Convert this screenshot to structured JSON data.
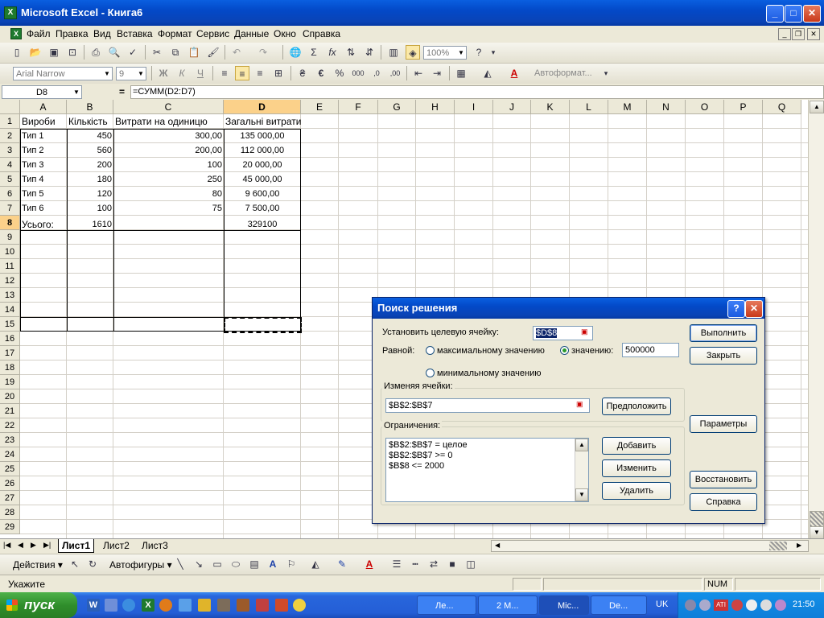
{
  "window": {
    "title": "Microsoft Excel - Книга6"
  },
  "menu": {
    "items": [
      "Файл",
      "Правка",
      "Вид",
      "Вставка",
      "Формат",
      "Сервис",
      "Данные",
      "Окно",
      "Справка"
    ]
  },
  "toolbar": {
    "zoom": "100%",
    "font_name": "Arial Narrow",
    "font_size": "9",
    "autoformat_label": "Автоформат...",
    "bold": "Ж",
    "italic": "К",
    "underline": "Ч",
    "thousands": "000"
  },
  "formula_bar": {
    "name_box": "D8",
    "eq": "=",
    "formula": "=СУММ(D2:D7)"
  },
  "sheet": {
    "columns": [
      "A",
      "B",
      "C",
      "D",
      "E",
      "F",
      "G",
      "H",
      "I",
      "J",
      "K",
      "L",
      "M",
      "N",
      "O",
      "P",
      "Q"
    ],
    "rows": [
      "1",
      "2",
      "3",
      "4",
      "5",
      "6",
      "7",
      "8",
      "9",
      "10",
      "11",
      "12",
      "13",
      "14",
      "15",
      "16",
      "17",
      "18",
      "19",
      "20",
      "21",
      "22",
      "23",
      "24",
      "25",
      "26",
      "27",
      "28",
      "29"
    ],
    "header": [
      "Вироби",
      "Кількість",
      "Витрати на одиницю",
      "Загальні витрати"
    ],
    "data": [
      [
        "Тип 1",
        "450",
        "300,00",
        "135 000,00"
      ],
      [
        "Тип 2",
        "560",
        "200,00",
        "112 000,00"
      ],
      [
        "Тип 3",
        "200",
        "100",
        "20 000,00"
      ],
      [
        "Тип 4",
        "180",
        "250",
        "45 000,00"
      ],
      [
        "Тип 5",
        "120",
        "80",
        "9 600,00"
      ],
      [
        "Тип 6",
        "100",
        "75",
        "7 500,00"
      ]
    ],
    "total": [
      "Усього:",
      "1610",
      "",
      "329100"
    ]
  },
  "tabs": [
    "Лист1",
    "Лист2",
    "Лист3"
  ],
  "drawing": {
    "actions": "Действия",
    "autoshapes": "Автофигуры"
  },
  "status": {
    "text": "Укажите",
    "num": "NUM"
  },
  "dialog": {
    "title": "Поиск решения",
    "help": "?",
    "target_label": "Установить целевую ячейку:",
    "target_value": "$D$8",
    "equal_label": "Равной:",
    "opt_max": "максимальному значению",
    "opt_value": "значению:",
    "value": "500000",
    "opt_min": "минимальному значению",
    "changing_label": "Изменяя ячейки:",
    "changing_value": "$B$2:$B$7",
    "guess_btn": "Предположить",
    "constraints_label": "Ограничения:",
    "constraints": [
      "$B$2:$B$7 = целое",
      "$B$2:$B$7 >= 0",
      "$B$8 <= 2000"
    ],
    "add_btn": "Добавить",
    "change_btn": "Изменить",
    "delete_btn": "Удалить",
    "solve_btn": "Выполнить",
    "close_btn": "Закрыть",
    "params_btn": "Параметры",
    "reset_btn": "Восстановить",
    "help_btn": "Справка"
  },
  "taskbar": {
    "start": "пуск",
    "tasks": [
      "Ле...",
      "2 M...",
      "Mic...",
      "De..."
    ],
    "lang": "UK",
    "clock": "21:50"
  }
}
